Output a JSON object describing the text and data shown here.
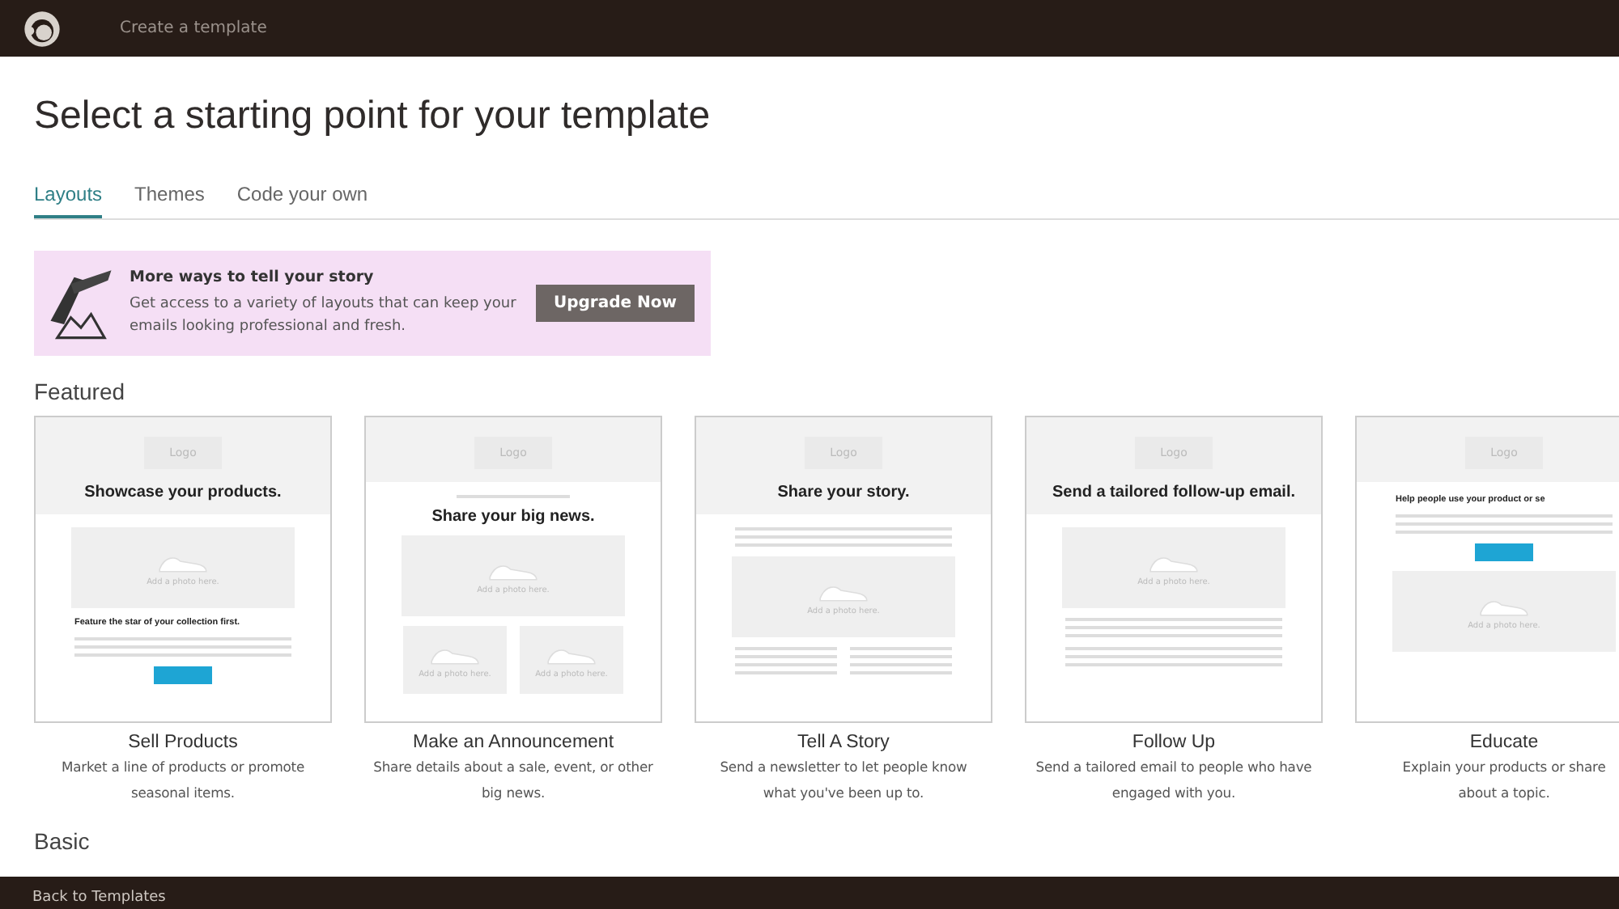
{
  "top_bar": {
    "title": "Create a template"
  },
  "heading": "Select a starting point for your template",
  "tabs": [
    {
      "label": "Layouts",
      "selected": true
    },
    {
      "label": "Themes",
      "selected": false
    },
    {
      "label": "Code your own",
      "selected": false
    }
  ],
  "promo": {
    "title": "More ways to tell your story",
    "text": "Get access to a variety of layouts that can keep your emails looking professional and fresh.",
    "button": "Upgrade Now"
  },
  "sections": [
    {
      "title": "Featured",
      "cards": [
        {
          "name": "Sell Products",
          "description_lines": [
            "Market a line of products or promote",
            "seasonal items."
          ],
          "preview": [
            {
              "kind": "logo",
              "text": "Logo"
            },
            {
              "kind": "headline",
              "text": "Showcase your products."
            },
            {
              "kind": "photo",
              "text": "Add a photo here."
            },
            {
              "kind": "subheading",
              "text": "Feature the star of your collection first."
            },
            {
              "kind": "lines"
            },
            {
              "kind": "button"
            }
          ]
        },
        {
          "name": "Make an Announcement",
          "description_lines": [
            "Share details about a sale, event, or other",
            "big news."
          ],
          "preview": [
            {
              "kind": "logo",
              "text": "Logo"
            },
            {
              "kind": "kicker"
            },
            {
              "kind": "headline",
              "text": "Share your big news."
            },
            {
              "kind": "photo",
              "text": "Add a photo here."
            },
            {
              "kind": "photo-pair",
              "texts": [
                "Add a photo here.",
                "Add a photo here."
              ]
            }
          ]
        },
        {
          "name": "Tell A Story",
          "description_lines": [
            "Send a newsletter to let people know",
            "what you've been up to."
          ],
          "preview": [
            {
              "kind": "logo",
              "text": "Logo"
            },
            {
              "kind": "headline",
              "text": "Share your story."
            },
            {
              "kind": "lines"
            },
            {
              "kind": "photo",
              "text": "Add a photo here."
            },
            {
              "kind": "columns"
            }
          ]
        },
        {
          "name": "Follow Up",
          "description_lines": [
            "Send a tailored email to people who have",
            "engaged with you."
          ],
          "preview": [
            {
              "kind": "logo",
              "text": "Logo"
            },
            {
              "kind": "headline",
              "text": "Send a tailored follow-up email."
            },
            {
              "kind": "photo",
              "text": "Add a photo here."
            },
            {
              "kind": "lines"
            },
            {
              "kind": "lines"
            }
          ]
        },
        {
          "name": "Educate",
          "description_lines": [
            "Explain your products or share",
            "about a topic."
          ],
          "preview": [
            {
              "kind": "logo",
              "text": "Logo"
            },
            {
              "kind": "subheading",
              "text": "Help people use your product or se"
            },
            {
              "kind": "lines"
            },
            {
              "kind": "button"
            },
            {
              "kind": "photo",
              "text": "Add a photo here."
            }
          ]
        }
      ]
    },
    {
      "title": "Basic"
    }
  ],
  "bottom_bar": {
    "link": "Back to Templates"
  }
}
